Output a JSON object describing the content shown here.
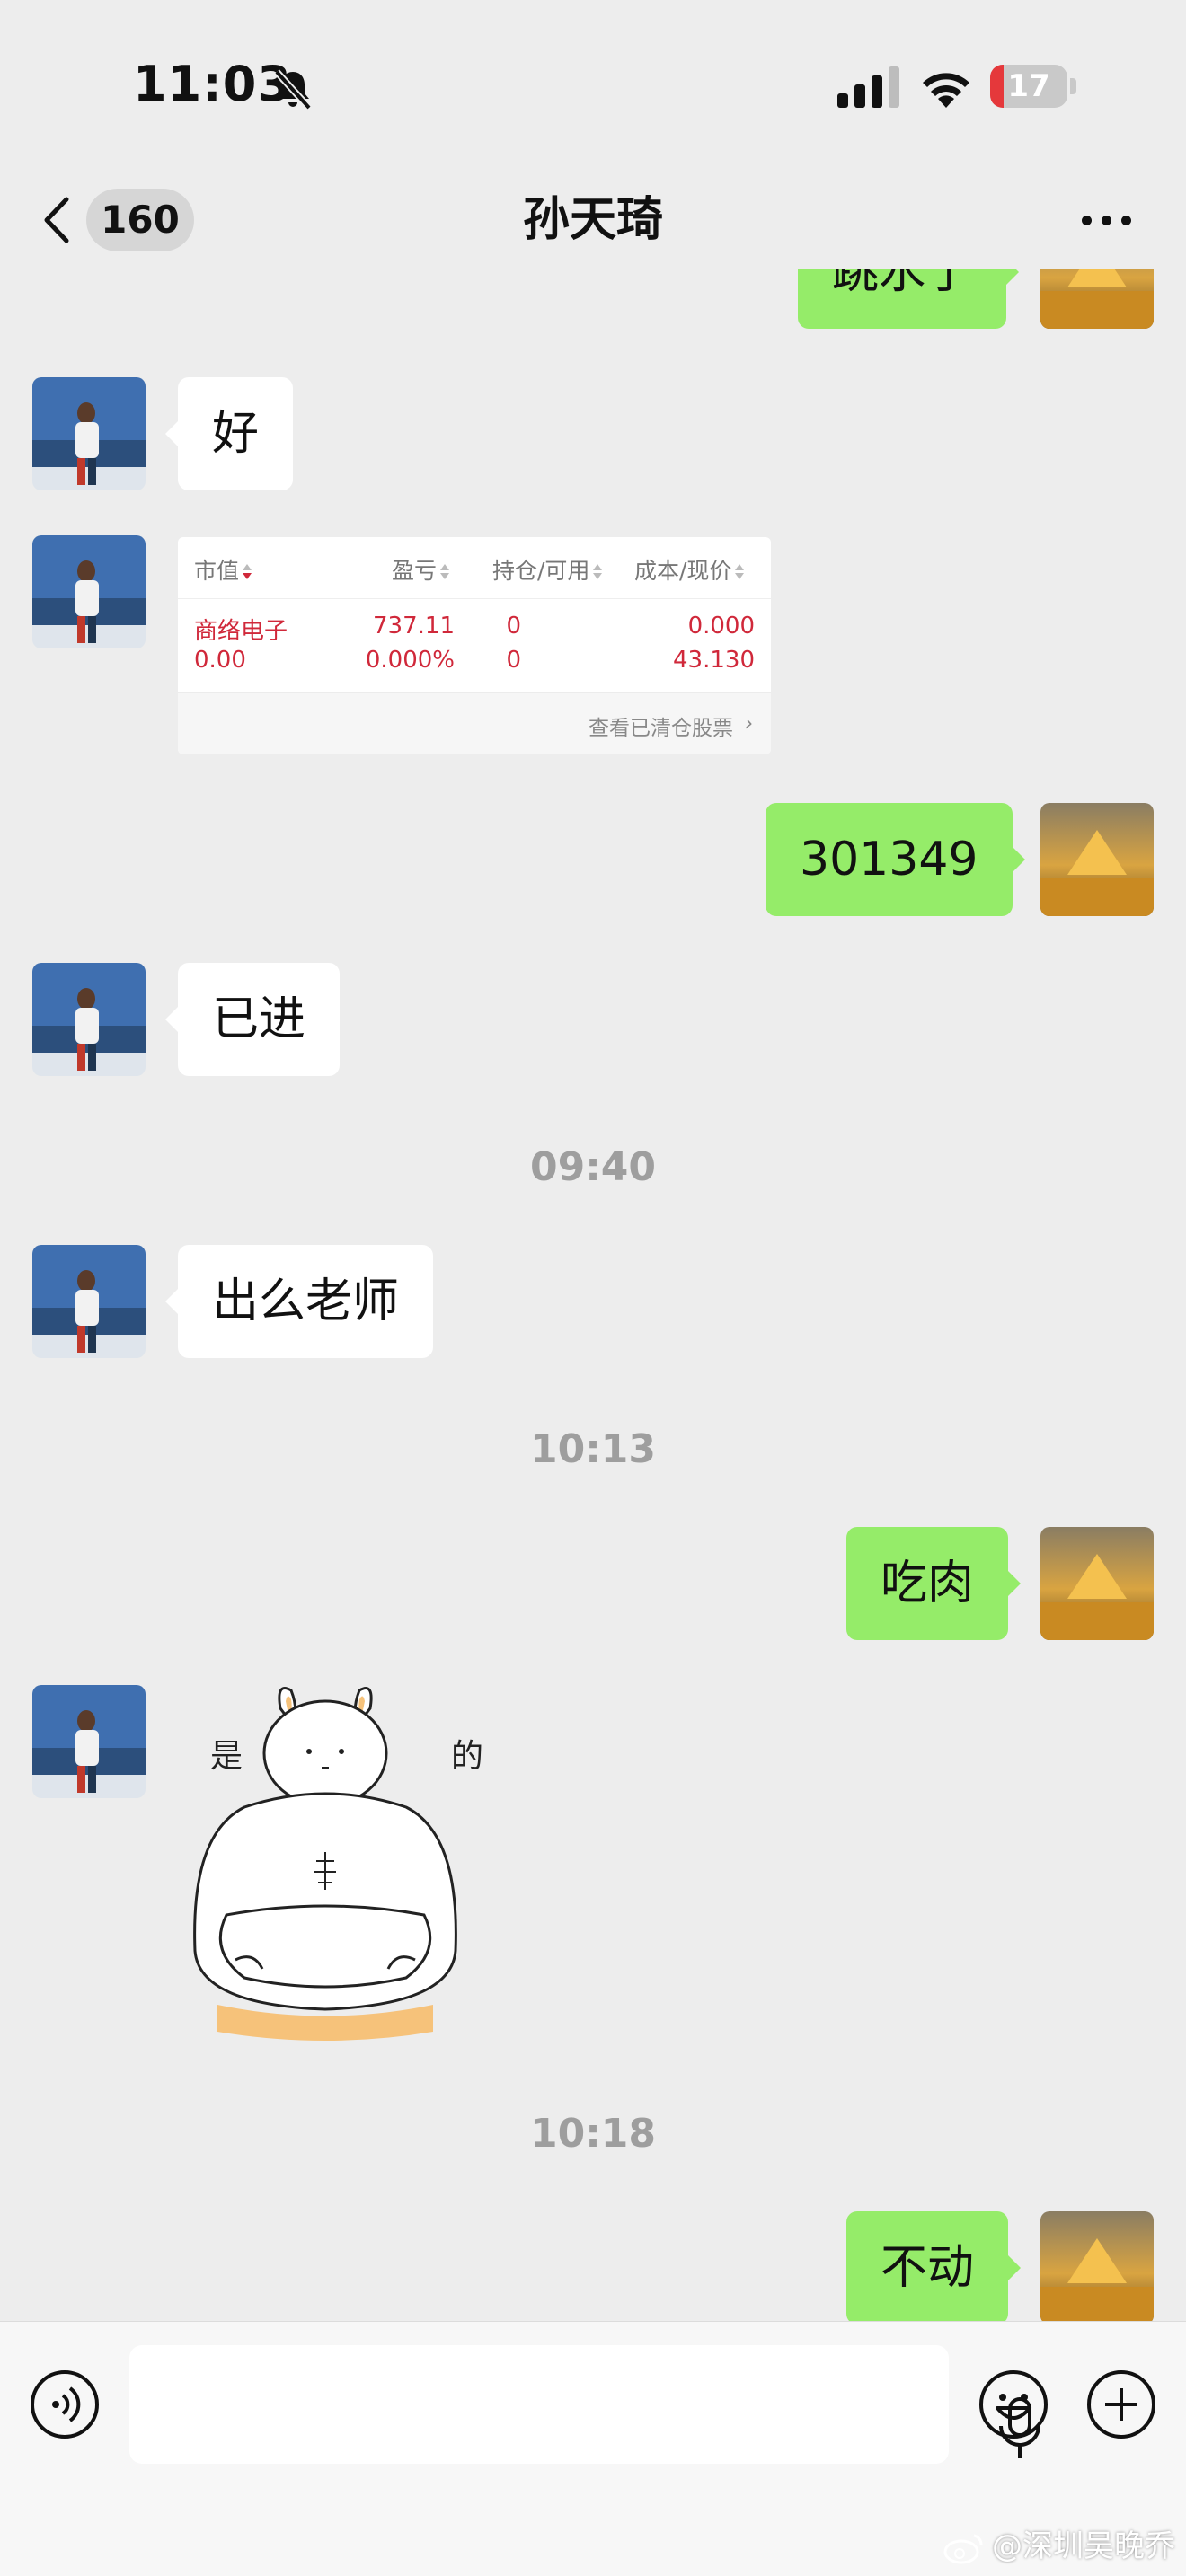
{
  "status_bar": {
    "time": "11:03",
    "battery_level": "17",
    "battery_color": "#e5383b"
  },
  "nav": {
    "back_badge": "160",
    "title": "孙天琦"
  },
  "messages": {
    "partial_top": "跳水了",
    "m1": "好",
    "m2": "301349",
    "m3": "已进",
    "ts1": "09:40",
    "m4": "出么老师",
    "ts2": "10:13",
    "m5": "吃肉",
    "ts3": "10:18",
    "m6": "不动"
  },
  "stock_card": {
    "headers": [
      "市值",
      "盈亏",
      "持仓/可用",
      "成本/现价"
    ],
    "name": "商络电子",
    "pnl": "737.11",
    "position": "0",
    "cost": "0.000",
    "market_value": "0.00",
    "pnl_pct": "0.000%",
    "available": "0",
    "price": "43.130",
    "footer_link": "查看已清仓股票"
  },
  "sticker": {
    "text_left": "是",
    "text_right": "的"
  },
  "input_bar": {
    "placeholder": ""
  },
  "watermark": "@深圳吴晚乔",
  "colors": {
    "background": "#ededed",
    "bubble_in": "#ffffff",
    "bubble_out": "#95ec69",
    "stock_red": "#d0283a"
  }
}
